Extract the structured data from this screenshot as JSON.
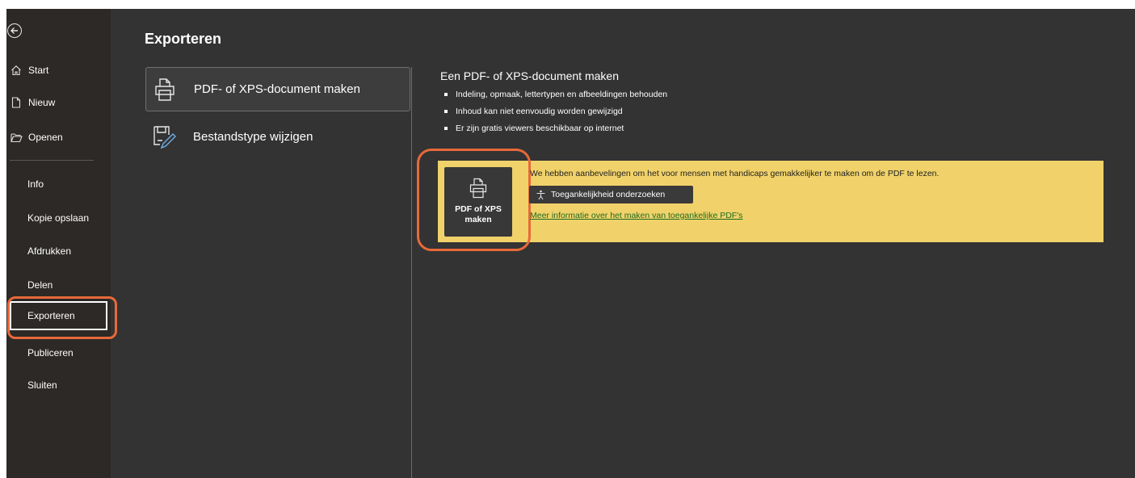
{
  "nav": {
    "items": [
      {
        "label": "Start",
        "icon": "home-icon"
      },
      {
        "label": "Nieuw",
        "icon": "new-document-icon"
      },
      {
        "label": "Openen",
        "icon": "folder-open-icon"
      },
      {
        "label": "Info"
      },
      {
        "label": "Kopie opslaan"
      },
      {
        "label": "Afdrukken"
      },
      {
        "label": "Delen"
      },
      {
        "label": "Exporteren",
        "selected": true
      },
      {
        "label": "Publiceren"
      },
      {
        "label": "Sluiten"
      }
    ]
  },
  "main": {
    "title": "Exporteren",
    "options": [
      {
        "label": "PDF- of XPS-document maken",
        "icon": "printer-document-icon",
        "selected": true
      },
      {
        "label": "Bestandstype wijzigen",
        "icon": "change-file-type-icon"
      }
    ]
  },
  "detail": {
    "title": "Een PDF- of XPS-document maken",
    "bullets": [
      "Indeling, opmaak, lettertypen en afbeeldingen behouden",
      "Inhoud kan niet eenvoudig worden gewijzigd",
      "Er zijn gratis viewers beschikbaar op internet"
    ],
    "create_button": {
      "line1": "PDF of XPS",
      "line2": "maken"
    },
    "recommendation_text": "We hebben aanbevelingen om het voor mensen met handicaps gemakkelijker te maken om de PDF te lezen.",
    "accessibility_button": "Toegankelijkheid onderzoeken",
    "more_info_link": "Meer informatie over het maken van toegankelijke PDF's"
  },
  "colors": {
    "highlight": "#e8693a",
    "banner": "#f1d26a",
    "background": "#333333"
  }
}
